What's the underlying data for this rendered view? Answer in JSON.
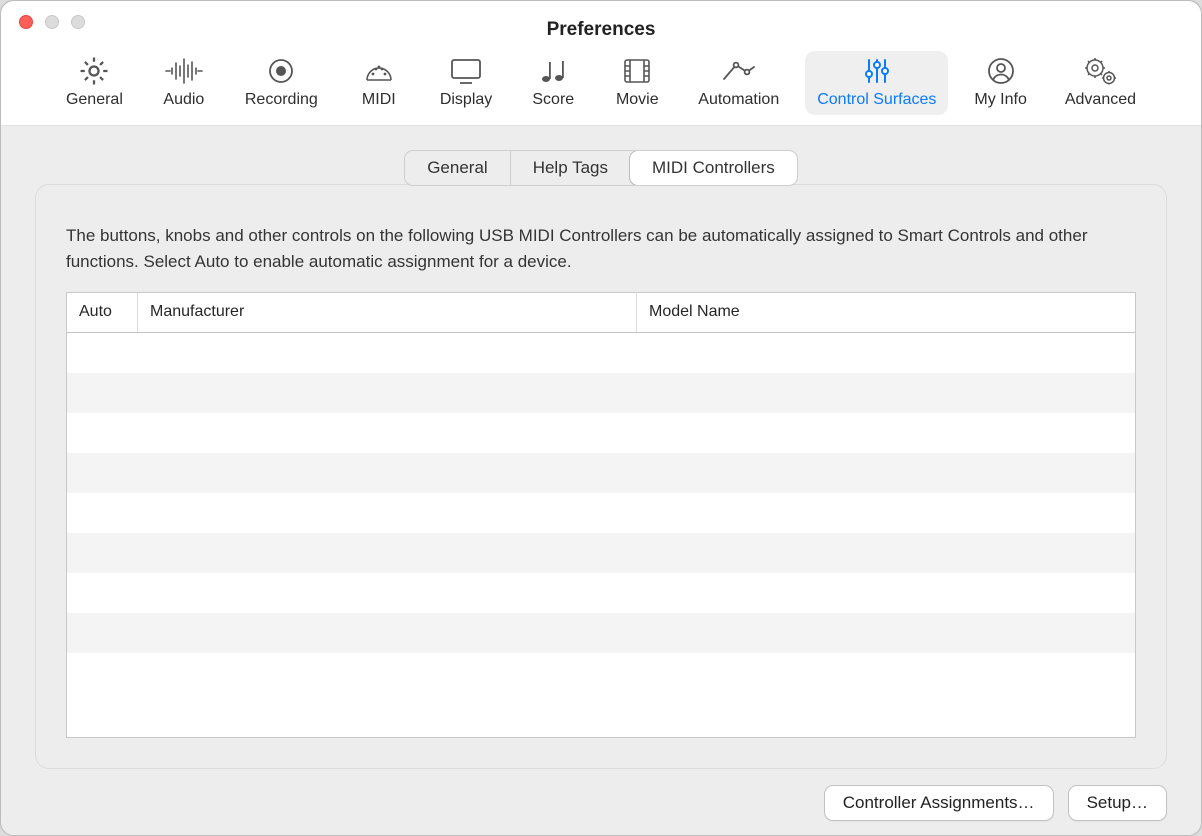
{
  "window": {
    "title": "Preferences"
  },
  "toolbar": {
    "items": [
      {
        "id": "general",
        "label": "General"
      },
      {
        "id": "audio",
        "label": "Audio"
      },
      {
        "id": "recording",
        "label": "Recording"
      },
      {
        "id": "midi",
        "label": "MIDI"
      },
      {
        "id": "display",
        "label": "Display"
      },
      {
        "id": "score",
        "label": "Score"
      },
      {
        "id": "movie",
        "label": "Movie"
      },
      {
        "id": "automation",
        "label": "Automation"
      },
      {
        "id": "control-surfaces",
        "label": "Control Surfaces",
        "active": true
      },
      {
        "id": "my-info",
        "label": "My Info"
      },
      {
        "id": "advanced",
        "label": "Advanced"
      }
    ]
  },
  "subtabs": {
    "items": [
      {
        "id": "general",
        "label": "General"
      },
      {
        "id": "help-tags",
        "label": "Help Tags"
      },
      {
        "id": "midi-controllers",
        "label": "MIDI Controllers",
        "active": true
      }
    ]
  },
  "description": "The buttons, knobs and other controls on the following USB MIDI Controllers can be automatically assigned to Smart Controls and other functions. Select Auto to enable automatic assignment for a device.",
  "table": {
    "columns": {
      "auto": "Auto",
      "manufacturer": "Manufacturer",
      "model": "Model Name"
    },
    "rows": []
  },
  "footer": {
    "controller_assignments": "Controller Assignments…",
    "setup": "Setup…"
  }
}
